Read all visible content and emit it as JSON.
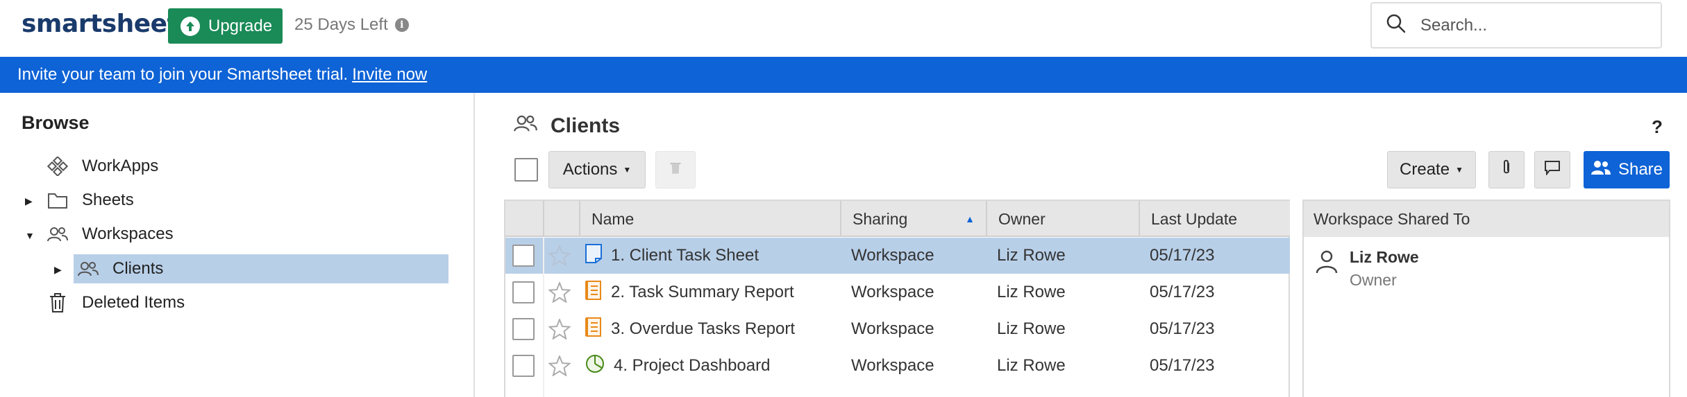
{
  "header": {
    "logo": "smartsheet",
    "upgrade_label": "Upgrade",
    "days_left": "25 Days Left",
    "search_placeholder": "Search..."
  },
  "banner": {
    "text": "Invite your team to join your Smartsheet trial.",
    "link": "Invite now"
  },
  "sidebar": {
    "title": "Browse",
    "items": [
      {
        "label": "WorkApps",
        "icon": "workapps-icon"
      },
      {
        "label": "Sheets",
        "icon": "folder-icon"
      },
      {
        "label": "Workspaces",
        "icon": "people-icon"
      },
      {
        "label": "Clients",
        "icon": "people-icon"
      },
      {
        "label": "Deleted Items",
        "icon": "trash-icon"
      }
    ]
  },
  "main": {
    "title": "Clients",
    "help": "?",
    "actions_label": "Actions",
    "create_label": "Create",
    "share_label": "Share"
  },
  "table": {
    "columns": [
      "Name",
      "Sharing",
      "Owner",
      "Last Update"
    ],
    "rows": [
      {
        "name": "1. Client Task Sheet",
        "sharing": "Workspace",
        "owner": "Liz Rowe",
        "updated": "05/17/23",
        "icon": "sheet-icon"
      },
      {
        "name": "2. Task Summary Report",
        "sharing": "Workspace",
        "owner": "Liz Rowe",
        "updated": "05/17/23",
        "icon": "report-icon"
      },
      {
        "name": "3. Overdue Tasks Report",
        "sharing": "Workspace",
        "owner": "Liz Rowe",
        "updated": "05/17/23",
        "icon": "report-icon"
      },
      {
        "name": "4. Project Dashboard",
        "sharing": "Workspace",
        "owner": "Liz Rowe",
        "updated": "05/17/23",
        "icon": "dashboard-icon"
      }
    ]
  },
  "panel": {
    "title": "Workspace Shared To",
    "person_name": "Liz Rowe",
    "person_role": "Owner"
  },
  "colors": {
    "brand_green": "#1a8a57",
    "accent_blue": "#0e63d6",
    "selected_row": "#b8cfe8",
    "logo_navy": "#1a3a6b"
  }
}
